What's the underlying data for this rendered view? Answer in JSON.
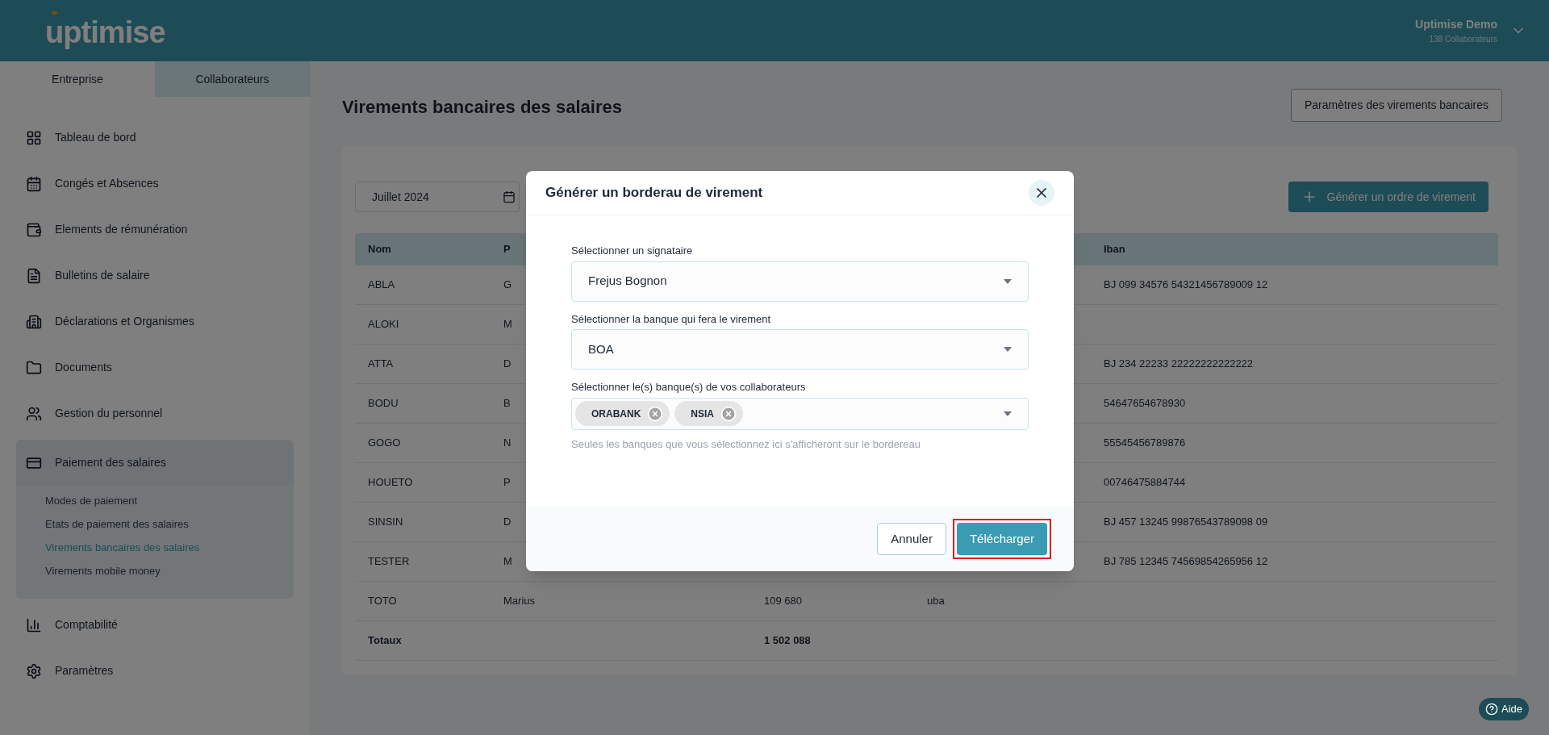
{
  "header": {
    "logo": "uptimise",
    "account_name": "Uptimise Demo",
    "account_subtitle": "138 Collaborateurs"
  },
  "sidebar": {
    "tabs": [
      {
        "label": "Entreprise",
        "selected": true
      },
      {
        "label": "Collaborateurs",
        "selected": false
      }
    ],
    "items": [
      {
        "label": "Tableau de bord",
        "expanded": false
      },
      {
        "label": "Congés et Absences",
        "expanded": false
      },
      {
        "label": "Elements de rémunération",
        "expanded": false
      },
      {
        "label": "Bulletins de salaire",
        "expanded": false
      },
      {
        "label": "Déclarations et Organismes",
        "expanded": false
      },
      {
        "label": "Documents",
        "expanded": false
      },
      {
        "label": "Gestion du personnel",
        "expanded": false
      },
      {
        "label": "Paiement des salaires",
        "expanded": true,
        "children": [
          {
            "label": "Modes de paiement",
            "selected": false
          },
          {
            "label": "Etats de paiement des salaires",
            "selected": false
          },
          {
            "label": "Virements bancaires des salaires",
            "selected": true
          },
          {
            "label": "Virements mobile money",
            "selected": false
          }
        ]
      },
      {
        "label": "Comptabilité",
        "expanded": false
      },
      {
        "label": "Paramètres",
        "expanded": false
      }
    ]
  },
  "page": {
    "title": "Virements bancaires des salaires",
    "settings_button": "Paramètres des virements bancaires",
    "period": "Juillet 2024",
    "generate_button": "Générer un ordre de virement"
  },
  "table": {
    "columns": {
      "nom": "Nom",
      "column_2": "P",
      "iban": "Iban"
    },
    "rows": [
      {
        "nom": "ABLA",
        "column_2": "G",
        "iban": "BJ 099 34576 54321456789009 12"
      },
      {
        "nom": "ALOKI",
        "column_2": "M"
      },
      {
        "nom": "ATTA",
        "column_2": "D",
        "iban": "BJ 234 22233 22222222222222"
      },
      {
        "nom": "BODU",
        "column_2": "B",
        "iban": "54647654678930"
      },
      {
        "nom": "GOGO",
        "column_2": "N",
        "iban": "55545456789876"
      },
      {
        "nom": "HOUETO",
        "column_2": "P",
        "iban": "00746475884744"
      },
      {
        "nom": "SINSIN",
        "column_2": "D",
        "iban": "BJ 457 13245 99876543789098 09"
      },
      {
        "nom": "TESTER",
        "column_2": "M",
        "iban": "BJ 785 12345 74569854265956 12"
      },
      {
        "nom": "TOTO",
        "column_2": "Marius",
        "column_3": "109 680",
        "column_4": "uba"
      }
    ],
    "totals": {
      "label": "Totaux",
      "column_3": "1 502 088"
    }
  },
  "modal": {
    "title": "Générer un borderau de virement",
    "fields": [
      {
        "kind": "select",
        "label": "Sélectionner un signataire",
        "value": "Frejus Bognon"
      },
      {
        "kind": "select",
        "label": "Sélectionner la banque qui fera le virement",
        "value": "BOA"
      },
      {
        "kind": "multiselect",
        "label": "Sélectionner le(s) banque(s) de vos collaborateurs",
        "chips": [
          "ORABANK",
          "NSIA"
        ],
        "hint": "Seules les banques que vous sélectionnez ici s'afficheront sur le bordereau"
      }
    ],
    "cancel_button": "Annuler",
    "download_button": {
      "label": "Télécharger",
      "highlighted": true
    }
  },
  "help_button": "Aide"
}
